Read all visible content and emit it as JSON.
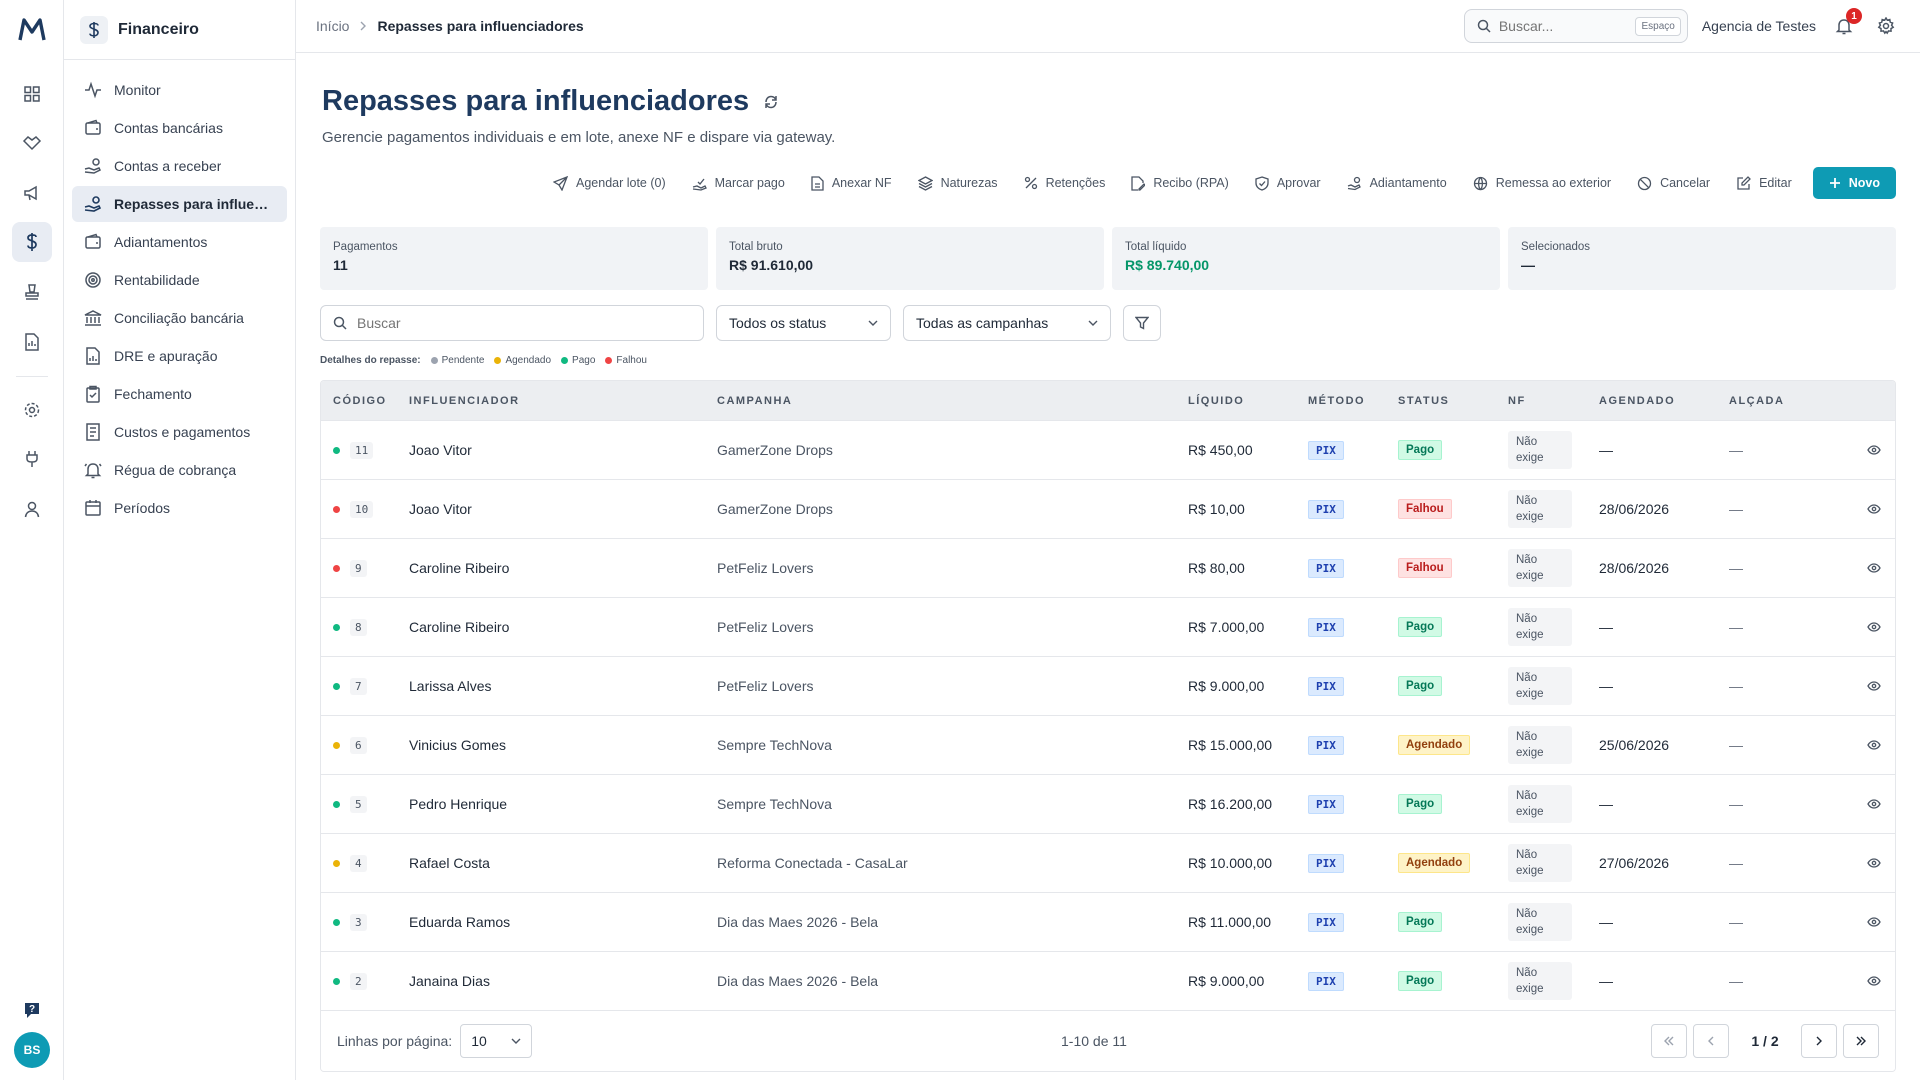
{
  "brand": {
    "logo_letter": "M",
    "accent": "#0e9bb4",
    "title_color": "#1e3a5f"
  },
  "rail": {
    "avatar_initials": "BS"
  },
  "sidebar": {
    "title": "Financeiro",
    "items": [
      {
        "label": "Monitor"
      },
      {
        "label": "Contas bancárias"
      },
      {
        "label": "Contas a receber"
      },
      {
        "label": "Repasses para influenciadores"
      },
      {
        "label": "Adiantamentos"
      },
      {
        "label": "Rentabilidade"
      },
      {
        "label": "Conciliação bancária"
      },
      {
        "label": "DRE e apuração"
      },
      {
        "label": "Fechamento"
      },
      {
        "label": "Custos e pagamentos"
      },
      {
        "label": "Régua de cobrança"
      },
      {
        "label": "Períodos"
      }
    ]
  },
  "topbar": {
    "breadcrumb": {
      "home": "Início",
      "current": "Repasses para influenciadores"
    },
    "search": {
      "placeholder": "Buscar...",
      "shortcut": "Espaço"
    },
    "agency": "Agencia de Testes",
    "notifications": "1"
  },
  "page": {
    "title": "Repasses para influenciadores",
    "subtitle": "Gerencie pagamentos individuais e em lote, anexe NF e dispare via gateway."
  },
  "toolbar": {
    "schedule_batch": "Agendar lote (0)",
    "mark_paid": "Marcar pago",
    "attach_nf": "Anexar NF",
    "natures": "Naturezas",
    "retentions": "Retenções",
    "receipt": "Recibo (RPA)",
    "approve": "Aprovar",
    "advance": "Adiantamento",
    "remittance": "Remessa ao exterior",
    "cancel": "Cancelar",
    "edit": "Editar",
    "new": "Novo"
  },
  "summary": {
    "payments": {
      "label": "Pagamentos",
      "value": "11"
    },
    "gross": {
      "label": "Total bruto",
      "value": "R$ 91.610,00"
    },
    "net": {
      "label": "Total líquido",
      "value": "R$ 89.740,00"
    },
    "selected": {
      "label": "Selecionados",
      "value": "—"
    }
  },
  "filters": {
    "search_placeholder": "Buscar",
    "status": "Todos os status",
    "campaigns": "Todas as campanhas"
  },
  "legend": {
    "title": "Detalhes do repasse:",
    "items": [
      {
        "label": "Pendente",
        "color": "#9ca3af"
      },
      {
        "label": "Agendado",
        "color": "#eab308"
      },
      {
        "label": "Pago",
        "color": "#10b981"
      },
      {
        "label": "Falhou",
        "color": "#ef4444"
      }
    ]
  },
  "table": {
    "headers": {
      "code": "Código",
      "influencer": "Influenciador",
      "campaign": "Campanha",
      "net": "Líquido",
      "method": "Método",
      "status": "Status",
      "nf": "NF",
      "scheduled": "Agendado",
      "approval": "Alçada"
    },
    "rows": [
      {
        "code": "11",
        "influencer": "Joao Vitor",
        "campaign": "GamerZone Drops",
        "net": "R$ 450,00",
        "method": "PIX",
        "status": "Pago",
        "kind": "pago",
        "nf1": "Não",
        "nf2": "exige",
        "scheduled": "—",
        "approval": "—"
      },
      {
        "code": "10",
        "influencer": "Joao Vitor",
        "campaign": "GamerZone Drops",
        "net": "R$ 10,00",
        "method": "PIX",
        "status": "Falhou",
        "kind": "falhou",
        "nf1": "Não",
        "nf2": "exige",
        "scheduled": "28/06/2026",
        "approval": "—"
      },
      {
        "code": "9",
        "influencer": "Caroline Ribeiro",
        "campaign": "PetFeliz Lovers",
        "net": "R$ 80,00",
        "method": "PIX",
        "status": "Falhou",
        "kind": "falhou",
        "nf1": "Não",
        "nf2": "exige",
        "scheduled": "28/06/2026",
        "approval": "—"
      },
      {
        "code": "8",
        "influencer": "Caroline Ribeiro",
        "campaign": "PetFeliz Lovers",
        "net": "R$ 7.000,00",
        "method": "PIX",
        "status": "Pago",
        "kind": "pago",
        "nf1": "Não",
        "nf2": "exige",
        "scheduled": "—",
        "approval": "—"
      },
      {
        "code": "7",
        "influencer": "Larissa Alves",
        "campaign": "PetFeliz Lovers",
        "net": "R$ 9.000,00",
        "method": "PIX",
        "status": "Pago",
        "kind": "pago",
        "nf1": "Não",
        "nf2": "exige",
        "scheduled": "—",
        "approval": "—"
      },
      {
        "code": "6",
        "influencer": "Vinicius Gomes",
        "campaign": "Sempre TechNova",
        "net": "R$ 15.000,00",
        "method": "PIX",
        "status": "Agendado",
        "kind": "agendado",
        "nf1": "Não",
        "nf2": "exige",
        "scheduled": "25/06/2026",
        "approval": "—"
      },
      {
        "code": "5",
        "influencer": "Pedro Henrique",
        "campaign": "Sempre TechNova",
        "net": "R$ 16.200,00",
        "method": "PIX",
        "status": "Pago",
        "kind": "pago",
        "nf1": "Não",
        "nf2": "exige",
        "scheduled": "—",
        "approval": "—"
      },
      {
        "code": "4",
        "influencer": "Rafael Costa",
        "campaign": "Reforma Conectada - CasaLar",
        "net": "R$ 10.000,00",
        "method": "PIX",
        "status": "Agendado",
        "kind": "agendado",
        "nf1": "Não",
        "nf2": "exige",
        "scheduled": "27/06/2026",
        "approval": "—"
      },
      {
        "code": "3",
        "influencer": "Eduarda Ramos",
        "campaign": "Dia das Maes 2026 - Bela",
        "net": "R$ 11.000,00",
        "method": "PIX",
        "status": "Pago",
        "kind": "pago",
        "nf1": "Não",
        "nf2": "exige",
        "scheduled": "—",
        "approval": "—"
      },
      {
        "code": "2",
        "influencer": "Janaina Dias",
        "campaign": "Dia das Maes 2026 - Bela",
        "net": "R$ 9.000,00",
        "method": "PIX",
        "status": "Pago",
        "kind": "pago",
        "nf1": "Não",
        "nf2": "exige",
        "scheduled": "—",
        "approval": "—"
      }
    ]
  },
  "pagination": {
    "rows_label": "Linhas por página:",
    "rows_value": "10",
    "range": "1-10 de 11",
    "page": "1 / 2"
  }
}
